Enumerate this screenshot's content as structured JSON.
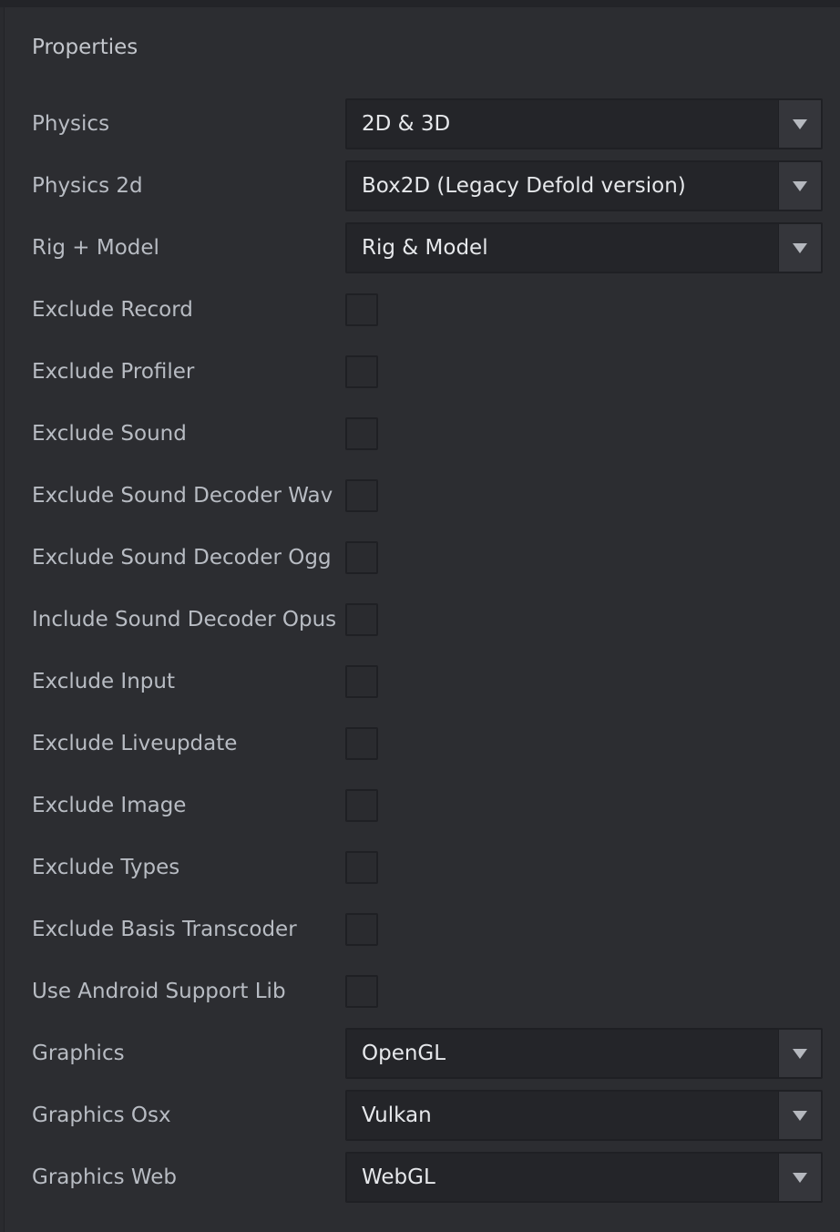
{
  "panel": {
    "title": "Properties"
  },
  "rows": [
    {
      "label": "Physics",
      "type": "select",
      "value": "2D & 3D"
    },
    {
      "label": "Physics 2d",
      "type": "select",
      "value": "Box2D (Legacy Defold version)"
    },
    {
      "label": "Rig + Model",
      "type": "select",
      "value": "Rig & Model"
    },
    {
      "label": "Exclude Record",
      "type": "checkbox",
      "checked": false
    },
    {
      "label": "Exclude Profiler",
      "type": "checkbox",
      "checked": false
    },
    {
      "label": "Exclude Sound",
      "type": "checkbox",
      "checked": false
    },
    {
      "label": "Exclude Sound Decoder Wav",
      "type": "checkbox",
      "checked": false
    },
    {
      "label": "Exclude Sound Decoder Ogg",
      "type": "checkbox",
      "checked": false
    },
    {
      "label": "Include Sound Decoder Opus",
      "type": "checkbox",
      "checked": false
    },
    {
      "label": "Exclude Input",
      "type": "checkbox",
      "checked": false
    },
    {
      "label": "Exclude Liveupdate",
      "type": "checkbox",
      "checked": false
    },
    {
      "label": "Exclude Image",
      "type": "checkbox",
      "checked": false
    },
    {
      "label": "Exclude Types",
      "type": "checkbox",
      "checked": false
    },
    {
      "label": "Exclude Basis Transcoder",
      "type": "checkbox",
      "checked": false
    },
    {
      "label": "Use Android Support Lib",
      "type": "checkbox",
      "checked": false
    },
    {
      "label": "Graphics",
      "type": "select",
      "value": "OpenGL"
    },
    {
      "label": "Graphics Osx",
      "type": "select",
      "value": "Vulkan"
    },
    {
      "label": "Graphics Web",
      "type": "select",
      "value": "WebGL"
    }
  ],
  "icons": {
    "dropdown": "chevron-down-icon"
  }
}
